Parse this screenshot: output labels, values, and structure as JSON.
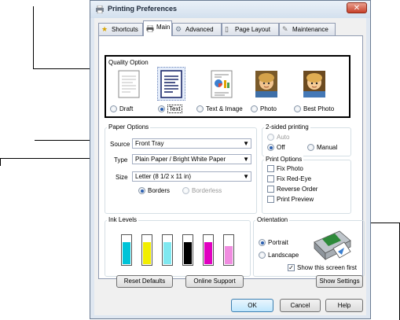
{
  "window": {
    "title": "Printing Preferences",
    "close": "✕"
  },
  "tabs": [
    {
      "label": "Shortcuts",
      "icon": "star-icon"
    },
    {
      "label": "Main",
      "icon": "printer-icon"
    },
    {
      "label": "Advanced",
      "icon": "gear-icon"
    },
    {
      "label": "Page Layout",
      "icon": "page-icon"
    },
    {
      "label": "Maintenance",
      "icon": "wrench-icon"
    }
  ],
  "quality": {
    "title": "Quality Option",
    "options": [
      {
        "label": "Draft",
        "selected": false
      },
      {
        "label": "Text",
        "selected": true
      },
      {
        "label": "Text & Image",
        "selected": false
      },
      {
        "label": "Photo",
        "selected": false
      },
      {
        "label": "Best Photo",
        "selected": false
      }
    ]
  },
  "paper": {
    "title": "Paper Options",
    "source_label": "Source",
    "source_value": "Front Tray",
    "type_label": "Type",
    "type_value": "Plain Paper / Bright White Paper",
    "size_label": "Size",
    "size_value": "Letter (8 1/2 x 11 in)",
    "borders": "Borders",
    "borderless": "Borderless"
  },
  "two_sided": {
    "title": "2-sided printing",
    "auto": "Auto",
    "off": "Off",
    "manual": "Manual"
  },
  "print_options": {
    "title": "Print Options",
    "items": [
      "Fix Photo",
      "Fix Red-Eye",
      "Reverse Order",
      "Print Preview"
    ]
  },
  "ink": {
    "title": "Ink Levels",
    "cartridges": [
      {
        "color": "#00c4d8",
        "level": 0.75
      },
      {
        "color": "#f2ee00",
        "level": 0.75
      },
      {
        "color": "#7fe8f0",
        "level": 0.75
      },
      {
        "color": "#000000",
        "level": 0.75
      },
      {
        "color": "#e000c0",
        "level": 0.75
      },
      {
        "color": "#f08ce0",
        "level": 0.6
      }
    ]
  },
  "orientation": {
    "title": "Orientation",
    "portrait": "Portrait",
    "landscape": "Landscape"
  },
  "show_screen_first": "Show this screen first",
  "buttons": {
    "reset": "Reset Defaults",
    "online": "Online Support",
    "show_settings": "Show Settings",
    "ok": "OK",
    "cancel": "Cancel",
    "help": "Help"
  },
  "colors": {
    "selection_border": "#000000",
    "accent": "#2b5fb0"
  }
}
